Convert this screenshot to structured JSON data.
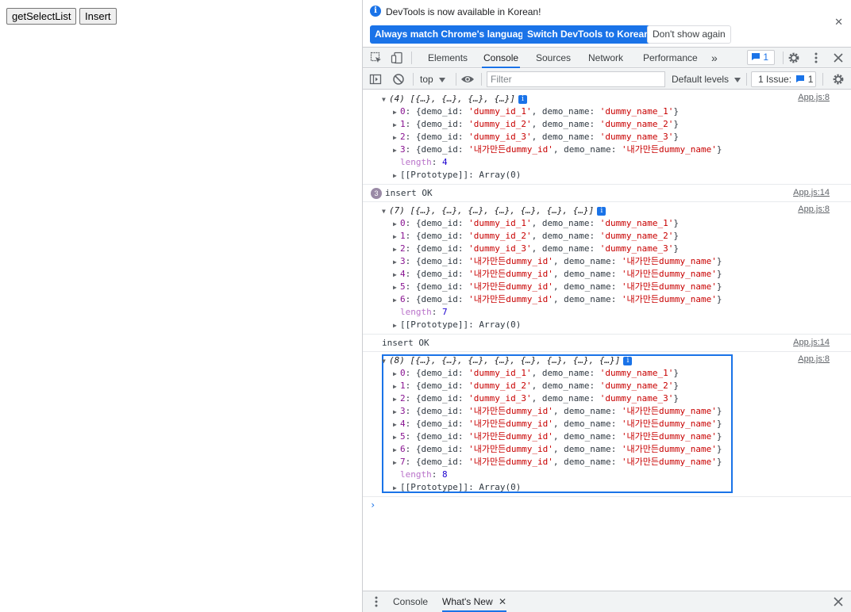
{
  "page": {
    "buttons": [
      "getSelectList",
      "Insert"
    ]
  },
  "infobar": {
    "message": "DevTools is now available in Korean!",
    "always_match": "Always match Chrome's language",
    "switch_korean": "Switch DevTools to Korean",
    "dont_show": "Don't show again",
    "close": "✕"
  },
  "tabs": [
    "Elements",
    "Console",
    "Sources",
    "Network",
    "Performance"
  ],
  "tabs_overflow": "»",
  "messages_count": "1",
  "toolbar": {
    "context": "top",
    "filter_placeholder": "Filter",
    "levels": "Default levels",
    "issues": "1 Issue:",
    "issues_count": "1"
  },
  "console": {
    "group1": {
      "summary": "(4) [{…}, {…}, {…}, {…}]",
      "source": "App.js:8",
      "items": [
        {
          "idx": "0",
          "id": "'dummy_id_1'",
          "name": "'dummy_name_1'"
        },
        {
          "idx": "1",
          "id": "'dummy_id_2'",
          "name": "'dummy_name_2'"
        },
        {
          "idx": "2",
          "id": "'dummy_id_3'",
          "name": "'dummy_name_3'"
        },
        {
          "idx": "3",
          "id": "'내가만든dummy_id'",
          "name": "'내가만든dummy_name'"
        }
      ],
      "length": "4",
      "prototype": "Array(0)"
    },
    "insert1": {
      "text": "insert OK",
      "count": "3",
      "source": "App.js:14"
    },
    "group2": {
      "summary": "(7) [{…}, {…}, {…}, {…}, {…}, {…}, {…}]",
      "source": "App.js:8",
      "items": [
        {
          "idx": "0",
          "id": "'dummy_id_1'",
          "name": "'dummy_name_1'"
        },
        {
          "idx": "1",
          "id": "'dummy_id_2'",
          "name": "'dummy_name_2'"
        },
        {
          "idx": "2",
          "id": "'dummy_id_3'",
          "name": "'dummy_name_3'"
        },
        {
          "idx": "3",
          "id": "'내가만든dummy_id'",
          "name": "'내가만든dummy_name'"
        },
        {
          "idx": "4",
          "id": "'내가만든dummy_id'",
          "name": "'내가만든dummy_name'"
        },
        {
          "idx": "5",
          "id": "'내가만든dummy_id'",
          "name": "'내가만든dummy_name'"
        },
        {
          "idx": "6",
          "id": "'내가만든dummy_id'",
          "name": "'내가만든dummy_name'"
        }
      ],
      "length": "7",
      "prototype": "Array(0)"
    },
    "insert2": {
      "text": "insert OK",
      "source": "App.js:14"
    },
    "group3": {
      "summary": "(8) [{…}, {…}, {…}, {…}, {…}, {…}, {…}, {…}]",
      "source": "App.js:8",
      "items": [
        {
          "idx": "0",
          "id": "'dummy_id_1'",
          "name": "'dummy_name_1'"
        },
        {
          "idx": "1",
          "id": "'dummy_id_2'",
          "name": "'dummy_name_2'"
        },
        {
          "idx": "2",
          "id": "'dummy_id_3'",
          "name": "'dummy_name_3'"
        },
        {
          "idx": "3",
          "id": "'내가만든dummy_id'",
          "name": "'내가만든dummy_name'"
        },
        {
          "idx": "4",
          "id": "'내가만든dummy_id'",
          "name": "'내가만든dummy_name'"
        },
        {
          "idx": "5",
          "id": "'내가만든dummy_id'",
          "name": "'내가만든dummy_name'"
        },
        {
          "idx": "6",
          "id": "'내가만든dummy_id'",
          "name": "'내가만든dummy_name'"
        },
        {
          "idx": "7",
          "id": "'내가만든dummy_id'",
          "name": "'내가만든dummy_name'"
        }
      ],
      "length": "8",
      "prototype": "Array(0)"
    },
    "labels": {
      "demo_id": "demo_id",
      "demo_name": "demo_name",
      "length": "length",
      "prototype_key": "[[Prototype]]"
    },
    "prompt": "›"
  },
  "drawer": {
    "tabs": [
      "Console",
      "What's New"
    ],
    "close_tab": "✕",
    "close": "✕"
  },
  "colors": {
    "accent": "#1a73e8",
    "string": "#c80000",
    "number": "#1c00cf",
    "property": "#881391"
  }
}
